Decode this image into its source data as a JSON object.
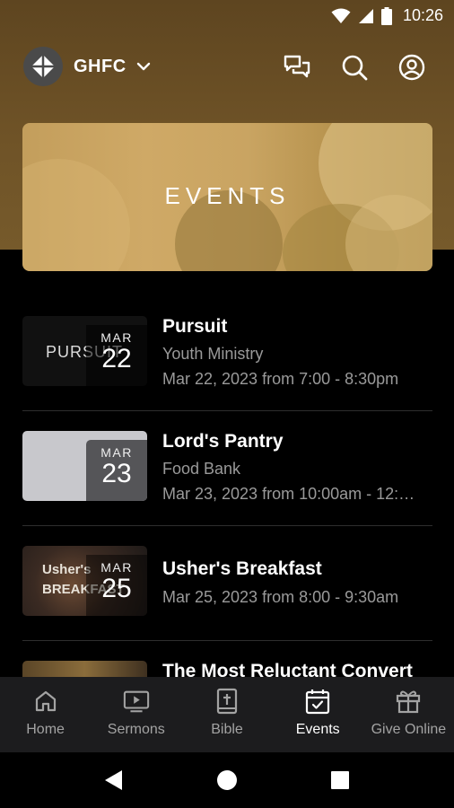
{
  "status_bar": {
    "time": "10:26"
  },
  "app_bar": {
    "org_name": "GHFC"
  },
  "banner": {
    "title": "EVENTS"
  },
  "events": [
    {
      "thumb_text": "PURSUIT",
      "month": "MAR",
      "day": "22",
      "title": "Pursuit",
      "subtitle": "Youth Ministry",
      "when": "Mar 22, 2023 from 7:00 - 8:30pm"
    },
    {
      "thumb_text": "",
      "month": "MAR",
      "day": "23",
      "title": "Lord's Pantry",
      "subtitle": "Food Bank",
      "when": "Mar 23, 2023 from 10:00am - 12:…"
    },
    {
      "thumb_text": "Usher's BREAKFAST",
      "month": "MAR",
      "day": "25",
      "title": "Usher's Breakfast",
      "subtitle": "",
      "when": "Mar 25, 2023 from 8:00 - 9:30am"
    },
    {
      "thumb_text": "",
      "month": "",
      "day": "",
      "title": "The Most Reluctant Convert",
      "subtitle": "",
      "when": ""
    }
  ],
  "bottom_nav": {
    "items": [
      {
        "label": "Home",
        "icon": "home-icon"
      },
      {
        "label": "Sermons",
        "icon": "video-icon"
      },
      {
        "label": "Bible",
        "icon": "bible-icon"
      },
      {
        "label": "Events",
        "icon": "calendar-check-icon",
        "active": true
      },
      {
        "label": "Give Online",
        "icon": "gift-icon"
      }
    ]
  },
  "colors": {
    "header_brown": "#6f5327",
    "banner_gold": "#cfa966",
    "nav_bg": "#1c1c1e"
  }
}
